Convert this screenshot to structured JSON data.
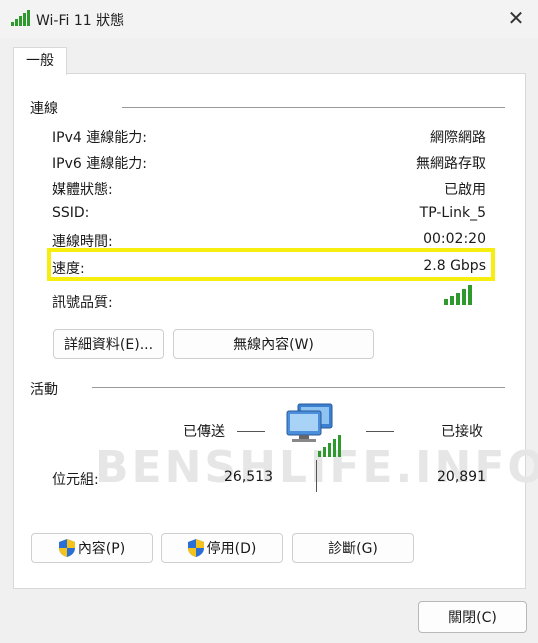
{
  "window": {
    "title": "Wi-Fi 11 狀態",
    "close_glyph": "✕"
  },
  "tabs": [
    {
      "label": "一般"
    }
  ],
  "connection": {
    "title": "連線",
    "rows": [
      {
        "label": "IPv4 連線能力:",
        "value": "網際網路"
      },
      {
        "label": "IPv6 連線能力:",
        "value": "無網路存取"
      },
      {
        "label": "媒體狀態:",
        "value": "已啟用"
      },
      {
        "label": "SSID:",
        "value": "TP-Link_5"
      },
      {
        "label": "連線時間:",
        "value": "00:02:20"
      },
      {
        "label": "速度:",
        "value": "2.8 Gbps"
      }
    ],
    "signal_label": "訊號品質:",
    "signal_bars_active": 5,
    "signal_bars_total": 5,
    "buttons": {
      "details": "詳細資料(E)...",
      "wireless_properties": "無線內容(W)"
    }
  },
  "activity": {
    "title": "活動",
    "sent_label": "已傳送",
    "received_label": "已接收",
    "bytes_label": "位元組:",
    "bytes_sent": "26,513",
    "bytes_received": "20,891"
  },
  "watermark": "BENSHLIFE.INFO",
  "bottom_buttons": {
    "properties": "內容(P)",
    "disable": "停用(D)",
    "diagnose": "診斷(G)"
  },
  "footer": {
    "close": "關閉(C)"
  },
  "colors": {
    "highlight": "#f6ee0e",
    "signal_green": "#2e9a2e",
    "shield_blue": "#2a6fd6",
    "shield_yellow": "#f3c21b"
  }
}
